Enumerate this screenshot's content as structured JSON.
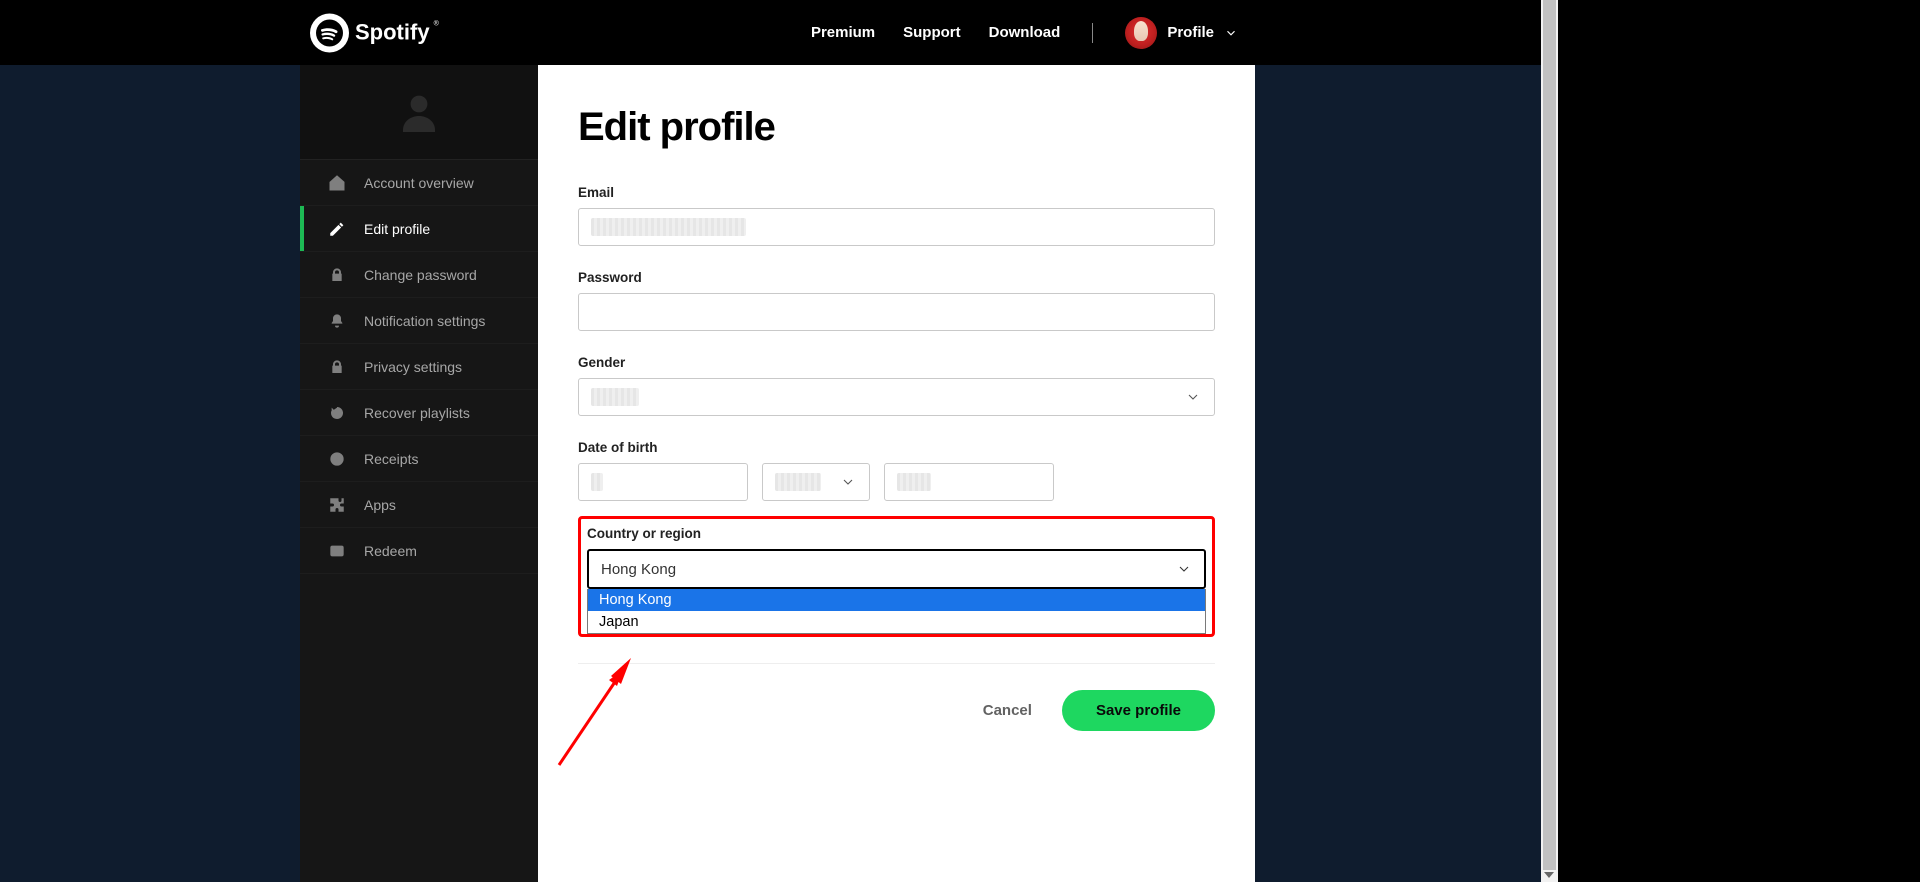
{
  "brand": {
    "name": "Spotify"
  },
  "nav": {
    "premium": "Premium",
    "support": "Support",
    "download": "Download",
    "profile_label": "Profile"
  },
  "sidebar": {
    "items": [
      {
        "label": "Account overview"
      },
      {
        "label": "Edit profile"
      },
      {
        "label": "Change password"
      },
      {
        "label": "Notification settings"
      },
      {
        "label": "Privacy settings"
      },
      {
        "label": "Recover playlists"
      },
      {
        "label": "Receipts"
      },
      {
        "label": "Apps"
      },
      {
        "label": "Redeem"
      }
    ]
  },
  "main": {
    "title": "Edit profile",
    "email_label": "Email",
    "email_value": "",
    "password_label": "Password",
    "password_value": "",
    "gender_label": "Gender",
    "gender_value": "",
    "dob_label": "Date of birth",
    "dob_day": "",
    "dob_month": "",
    "dob_year": "",
    "country_label": "Country or region",
    "country_value": "Hong Kong",
    "country_options": {
      "hk": "Hong Kong",
      "jp": "Japan"
    },
    "cancel_label": "Cancel",
    "save_label": "Save profile"
  }
}
